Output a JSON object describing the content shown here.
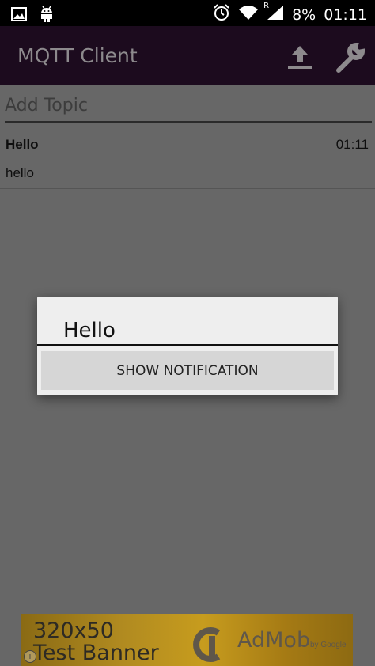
{
  "status_bar": {
    "battery": "8%",
    "time": "01:11",
    "roaming_indicator": "R",
    "icons": [
      "image-icon",
      "android-icon",
      "alarm-icon",
      "wifi-icon",
      "signal-icon",
      "battery-icon"
    ]
  },
  "app_bar": {
    "title": "MQTT Client",
    "actions": [
      "upload-icon",
      "wrench-icon"
    ]
  },
  "topic_input": {
    "placeholder": "Add Topic"
  },
  "messages": [
    {
      "topic": "Hello",
      "time": "01:11",
      "body": "hello"
    }
  ],
  "dialog": {
    "title": "Hello",
    "button_label": "SHOW NOTIFICATION"
  },
  "ad_banner": {
    "line1": "320x50",
    "line2": "Test Banner",
    "brand": "AdMob",
    "by_text": "by Google",
    "info": "i"
  },
  "colors": {
    "app_bar_bg": "#1c0b1e",
    "scrim": "#676767",
    "dialog_bg": "#eeeeee"
  }
}
